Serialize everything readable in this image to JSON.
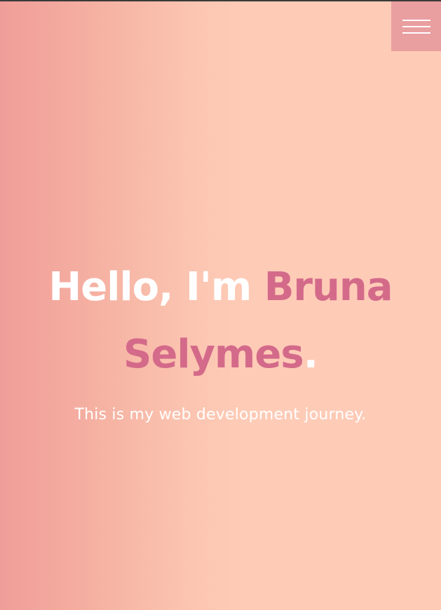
{
  "hero": {
    "greeting": "Hello, I'm",
    "first_name": "Bruna",
    "last_name": "Selymes",
    "period": ".",
    "tagline": "This is my web development journey."
  },
  "menu": {
    "icon": "hamburger-menu-icon"
  },
  "colors": {
    "accent": "#d46a8a",
    "menu_bg": "#e99ea0",
    "gradient_start": "#f09d98",
    "gradient_end": "#fecbb7",
    "text": "#ffffff"
  }
}
